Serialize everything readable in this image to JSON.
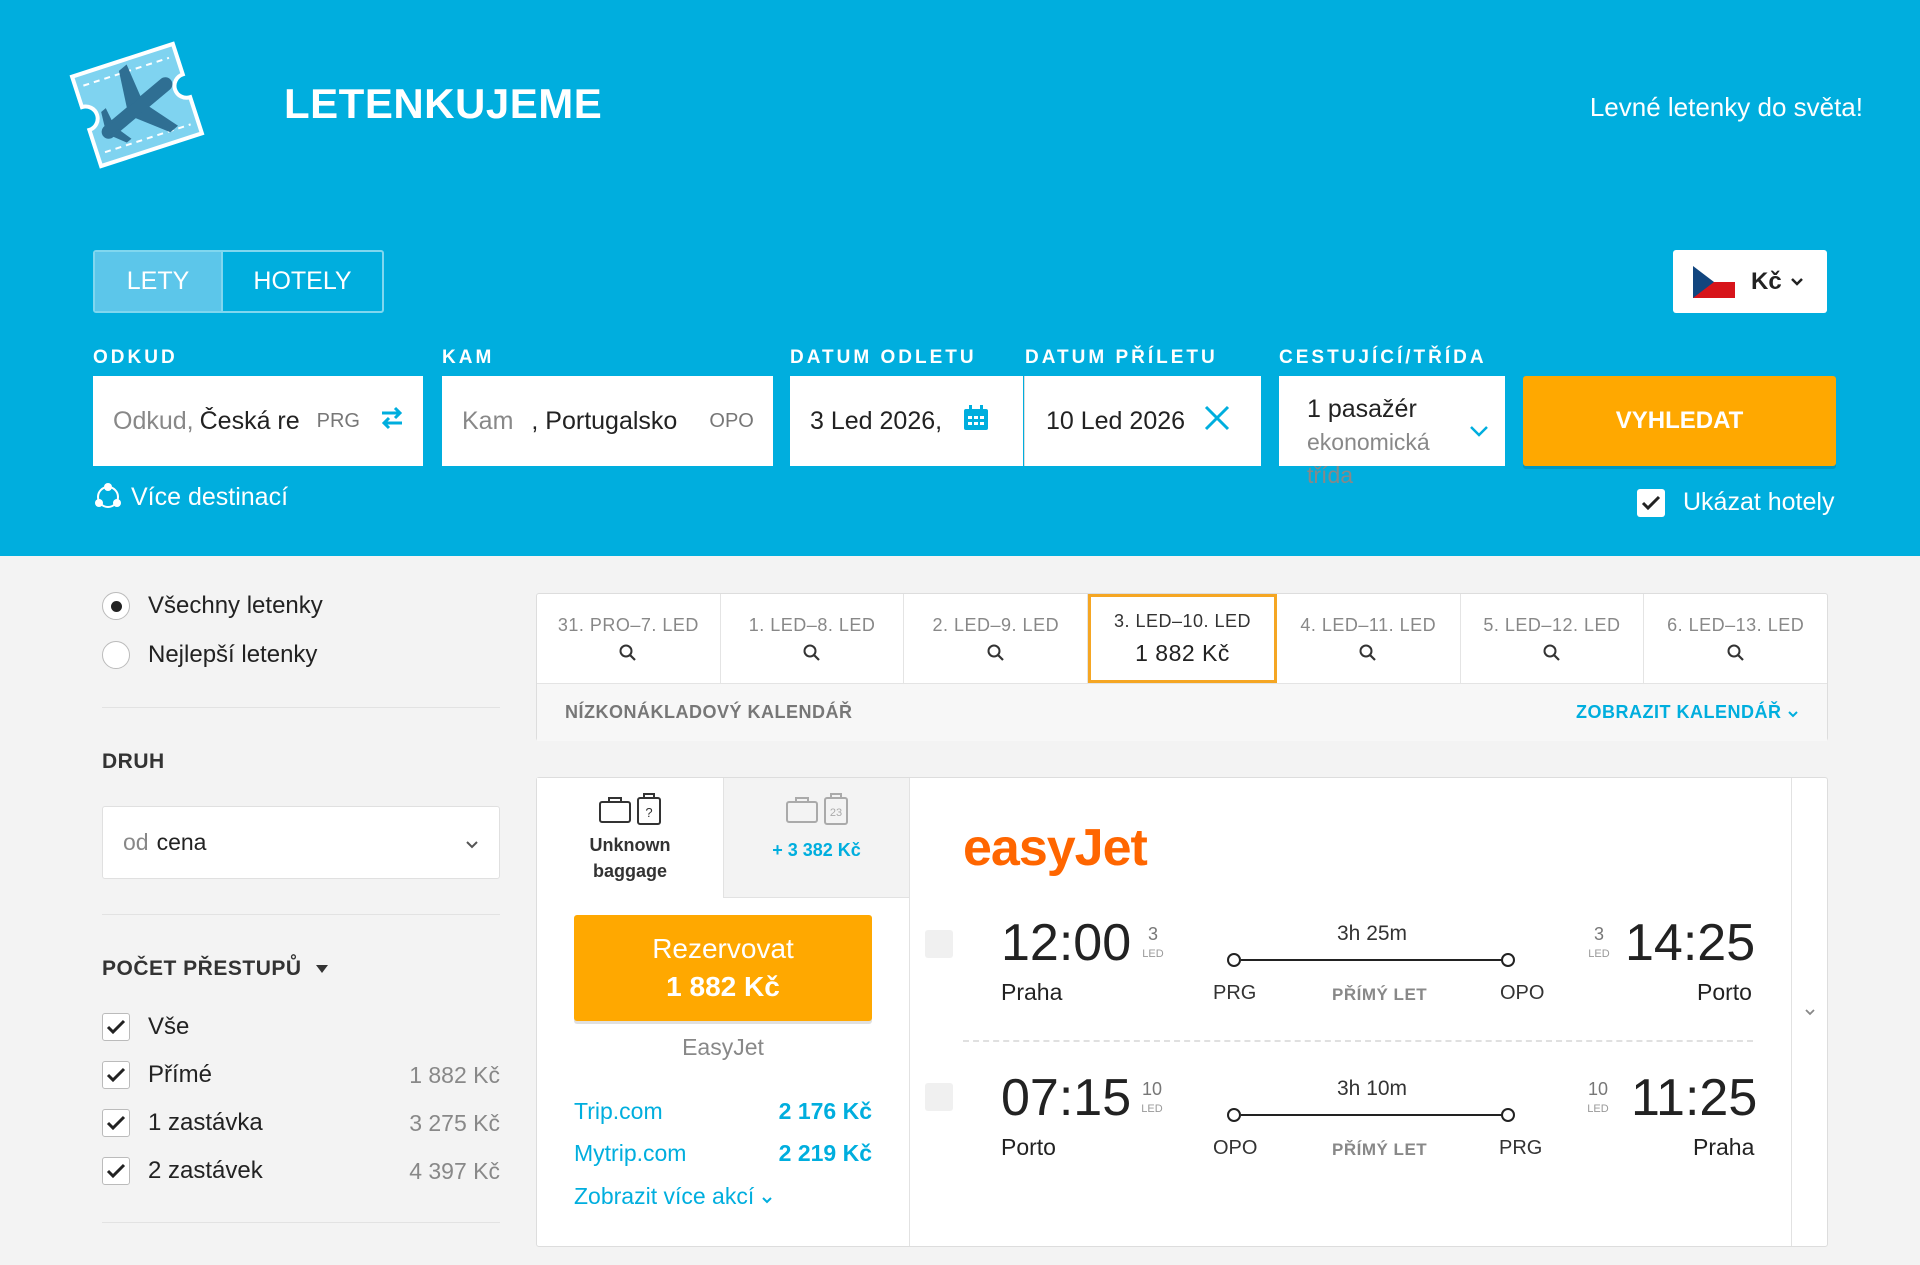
{
  "header": {
    "brand": "LETENKUJEME",
    "tagline": "Levné letenky do světa!",
    "tabs": [
      {
        "label": "LETY"
      },
      {
        "label": "HOTELY"
      }
    ],
    "currency": "Kč"
  },
  "search": {
    "odkud_label": "ODKUD",
    "odkud_placeholder": "Odkud,",
    "odkud_value": "Česká re",
    "odkud_code": "PRG",
    "kam_label": "KAM",
    "kam_placeholder": "Kam",
    "kam_value": ", Portugalsko",
    "kam_code": "OPO",
    "odlet_label": "DATUM ODLETU",
    "odlet_value": "3 Led 2026,",
    "prilet_label": "DATUM PŘÍLETU",
    "prilet_value": "10 Led 2026",
    "cestujici_label": "CESTUJÍCÍ/TŘÍDA",
    "passengers": "1 pasažér",
    "class": "ekonomická třída",
    "search_button": "VYHLEDAT",
    "more_destinations": "Více destinací",
    "show_hotels": "Ukázat hotely",
    "show_hotels_checked": true
  },
  "sidebar": {
    "radios": [
      {
        "label": "Všechny letenky",
        "selected": true
      },
      {
        "label": "Nejlepší letenky",
        "selected": false
      }
    ],
    "druh_heading": "DRUH",
    "sort_prefix": "od",
    "sort_value": "cena",
    "stops_heading": "POČET PŘESTUPŮ",
    "stops": [
      {
        "label": "Vše",
        "price": "",
        "checked": true
      },
      {
        "label": "Přímé",
        "price": "1 882 Kč",
        "checked": true
      },
      {
        "label": "1 zastávka",
        "price": "3 275 Kč",
        "checked": true
      },
      {
        "label": "2 zastávek",
        "price": "4 397 Kč",
        "checked": true
      }
    ]
  },
  "dates": {
    "items": [
      {
        "label": "31. PRO–7. LED",
        "price": ""
      },
      {
        "label": "1. LED–8. LED",
        "price": ""
      },
      {
        "label": "2. LED–9. LED",
        "price": ""
      },
      {
        "label": "3. LED–10. LED",
        "price": "1 882 Kč",
        "active": true
      },
      {
        "label": "4. LED–11. LED",
        "price": ""
      },
      {
        "label": "5. LED–12. LED",
        "price": ""
      },
      {
        "label": "6. LED–13. LED",
        "price": ""
      }
    ],
    "calendar_label": "NÍZKONÁKLADOVÝ KALENDÁŘ",
    "calendar_link": "ZOBRAZIT KALENDÁŘ"
  },
  "result": {
    "baggage_label_1": "Unknown",
    "baggage_label_2": "baggage",
    "baggage_extra_price": "+ 3 382 Kč",
    "baggage_icon_number": "23",
    "book_label": "Rezervovat",
    "book_price": "1 882 Kč",
    "provider": "EasyJet",
    "deals": [
      {
        "name": "Trip.com",
        "price": "2 176 Kč"
      },
      {
        "name": "Mytrip.com",
        "price": "2 219 Kč"
      }
    ],
    "more_deals": "Zobrazit více akcí",
    "airline": "easyJet",
    "segments": [
      {
        "dep_time": "12:00",
        "dep_day": "3",
        "dep_month": "LED",
        "dep_city": "Praha",
        "dep_code": "PRG",
        "duration": "3h 25m",
        "type": "PŘÍMÝ LET",
        "arr_time": "14:25",
        "arr_day": "3",
        "arr_month": "LED",
        "arr_city": "Porto",
        "arr_code": "OPO"
      },
      {
        "dep_time": "07:15",
        "dep_day": "10",
        "dep_month": "LED",
        "dep_city": "Porto",
        "dep_code": "OPO",
        "duration": "3h 10m",
        "type": "PŘÍMÝ LET",
        "arr_time": "11:25",
        "arr_day": "10",
        "arr_month": "LED",
        "arr_city": "Praha",
        "arr_code": "PRG"
      }
    ]
  },
  "colors": {
    "header_bg": "#00aede",
    "accent_orange": "#ffa800",
    "link_blue": "#00aede",
    "easyjet_orange": "#ff6600"
  }
}
